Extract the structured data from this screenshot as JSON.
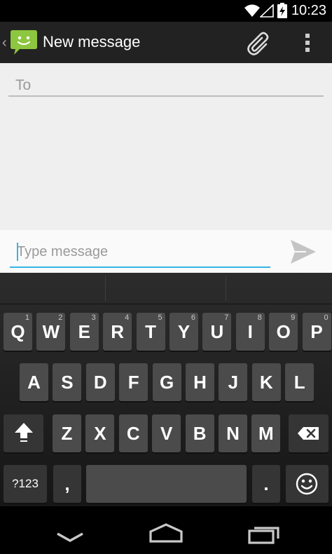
{
  "status_bar": {
    "time": "10:23"
  },
  "action_bar": {
    "title": "New message"
  },
  "recipient": {
    "placeholder": "To"
  },
  "composer": {
    "placeholder": "Type message"
  },
  "keyboard": {
    "row1": [
      {
        "label": "Q",
        "hint": "1"
      },
      {
        "label": "W",
        "hint": "2"
      },
      {
        "label": "E",
        "hint": "3"
      },
      {
        "label": "R",
        "hint": "4"
      },
      {
        "label": "T",
        "hint": "5"
      },
      {
        "label": "Y",
        "hint": "6"
      },
      {
        "label": "U",
        "hint": "7"
      },
      {
        "label": "I",
        "hint": "8"
      },
      {
        "label": "O",
        "hint": "9"
      },
      {
        "label": "P",
        "hint": "0"
      }
    ],
    "row2": [
      "A",
      "S",
      "D",
      "F",
      "G",
      "H",
      "J",
      "K",
      "L"
    ],
    "row3": [
      "Z",
      "X",
      "C",
      "V",
      "B",
      "N",
      "M"
    ],
    "symbols_label": "?123",
    "comma_label": ",",
    "period_label": "."
  }
}
